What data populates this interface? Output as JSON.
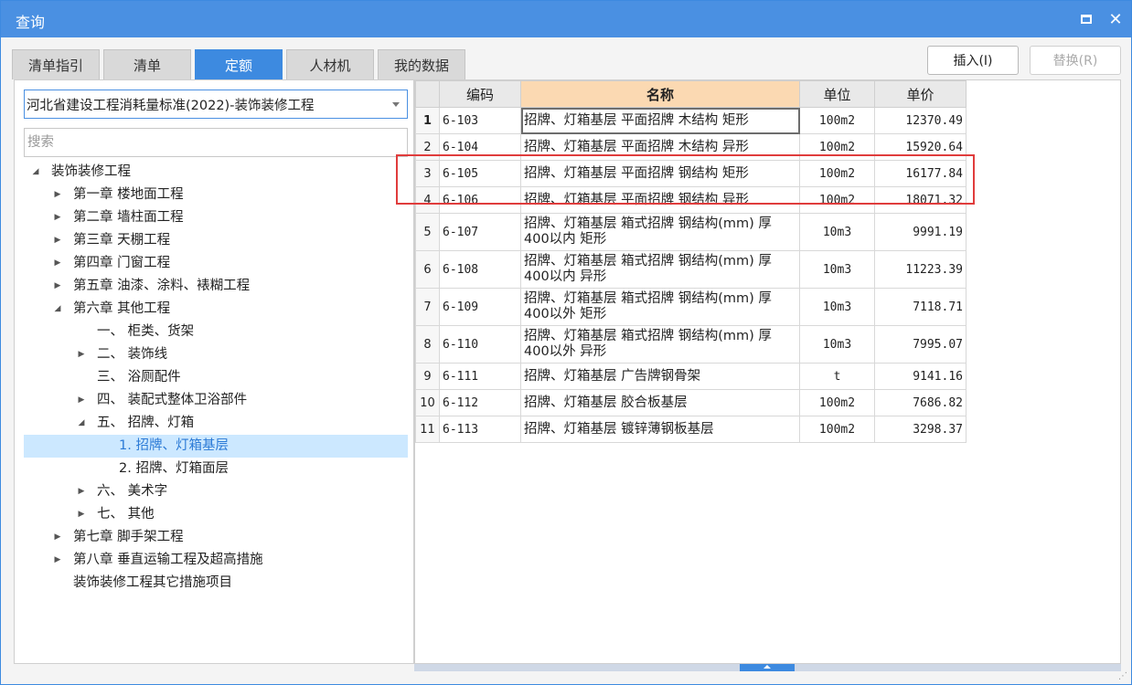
{
  "window": {
    "title": "查询"
  },
  "tabs": [
    {
      "label": "清单指引"
    },
    {
      "label": "清单"
    },
    {
      "label": "定额",
      "active": true
    },
    {
      "label": "人材机"
    },
    {
      "label": "我的数据"
    }
  ],
  "actions": {
    "insert": "插入(I)",
    "replace": "替换(R)"
  },
  "library": {
    "selected": "河北省建设工程消耗量标准(2022)-装饰装修工程"
  },
  "search": {
    "placeholder": "搜索"
  },
  "tree": [
    {
      "label": "装饰装修工程",
      "level": 0,
      "arrow": "expanded"
    },
    {
      "label": "第一章 楼地面工程",
      "level": 1,
      "arrow": "collapsed"
    },
    {
      "label": "第二章 墙柱面工程",
      "level": 1,
      "arrow": "collapsed"
    },
    {
      "label": "第三章 天棚工程",
      "level": 1,
      "arrow": "collapsed"
    },
    {
      "label": "第四章 门窗工程",
      "level": 1,
      "arrow": "collapsed"
    },
    {
      "label": "第五章 油漆、涂料、裱糊工程",
      "level": 1,
      "arrow": "collapsed"
    },
    {
      "label": "第六章 其他工程",
      "level": 1,
      "arrow": "expanded"
    },
    {
      "label": "一、 柜类、货架",
      "level": 2,
      "arrow": "none"
    },
    {
      "label": "二、 装饰线",
      "level": 2,
      "arrow": "collapsed"
    },
    {
      "label": "三、 浴厕配件",
      "level": 2,
      "arrow": "none"
    },
    {
      "label": "四、 装配式整体卫浴部件",
      "level": 2,
      "arrow": "collapsed"
    },
    {
      "label": "五、 招牌、灯箱",
      "level": 2,
      "arrow": "expanded"
    },
    {
      "label": "1. 招牌、灯箱基层",
      "level": 3,
      "arrow": "none",
      "selected": true
    },
    {
      "label": "2. 招牌、灯箱面层",
      "level": 3,
      "arrow": "none"
    },
    {
      "label": "六、 美术字",
      "level": 2,
      "arrow": "collapsed"
    },
    {
      "label": "七、 其他",
      "level": 2,
      "arrow": "collapsed"
    },
    {
      "label": "第七章 脚手架工程",
      "level": 1,
      "arrow": "collapsed"
    },
    {
      "label": "第八章 垂直运输工程及超高措施",
      "level": 1,
      "arrow": "collapsed"
    },
    {
      "label": "装饰装修工程其它措施项目",
      "level": 1,
      "arrow": "none"
    }
  ],
  "grid": {
    "columns": {
      "code": "编码",
      "name": "名称",
      "unit": "单位",
      "price": "单价"
    },
    "rows": [
      {
        "no": "1",
        "code": "6-103",
        "name": "招牌、灯箱基层 平面招牌 木结构 矩形",
        "unit": "100m2",
        "price": "12370.49"
      },
      {
        "no": "2",
        "code": "6-104",
        "name": "招牌、灯箱基层 平面招牌 木结构 异形",
        "unit": "100m2",
        "price": "15920.64"
      },
      {
        "no": "3",
        "code": "6-105",
        "name": "招牌、灯箱基层 平面招牌 钢结构 矩形",
        "unit": "100m2",
        "price": "16177.84"
      },
      {
        "no": "4",
        "code": "6-106",
        "name": "招牌、灯箱基层 平面招牌 钢结构 异形",
        "unit": "100m2",
        "price": "18071.32"
      },
      {
        "no": "5",
        "code": "6-107",
        "name": "招牌、灯箱基层 箱式招牌 钢结构(mm) 厚400以内 矩形",
        "unit": "10m3",
        "price": "9991.19"
      },
      {
        "no": "6",
        "code": "6-108",
        "name": "招牌、灯箱基层 箱式招牌 钢结构(mm) 厚400以内 异形",
        "unit": "10m3",
        "price": "11223.39"
      },
      {
        "no": "7",
        "code": "6-109",
        "name": "招牌、灯箱基层 箱式招牌 钢结构(mm) 厚400以外 矩形",
        "unit": "10m3",
        "price": "7118.71"
      },
      {
        "no": "8",
        "code": "6-110",
        "name": "招牌、灯箱基层 箱式招牌 钢结构(mm) 厚400以外 异形",
        "unit": "10m3",
        "price": "7995.07"
      },
      {
        "no": "9",
        "code": "6-111",
        "name": "招牌、灯箱基层 广告牌钢骨架",
        "unit": "t",
        "price": "9141.16"
      },
      {
        "no": "10",
        "code": "6-112",
        "name": "招牌、灯箱基层 胶合板基层",
        "unit": "100m2",
        "price": "7686.82"
      },
      {
        "no": "11",
        "code": "6-113",
        "name": "招牌、灯箱基层 镀锌薄钢板基层",
        "unit": "100m2",
        "price": "3298.37"
      }
    ]
  }
}
